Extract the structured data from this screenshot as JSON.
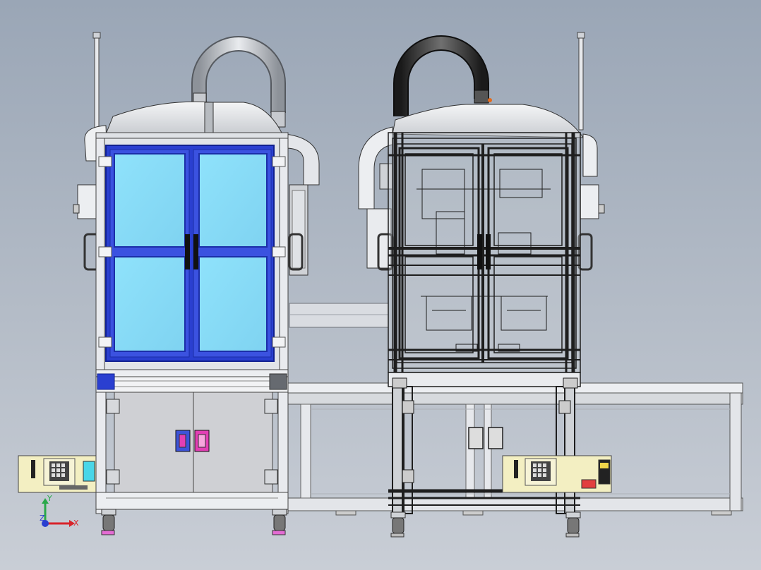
{
  "viewport": {
    "background_top": "#9aa6b6",
    "background_bottom": "#c9ced6"
  },
  "colors": {
    "frame_blue": "#2a3fd0",
    "glass_blue": "#86dcf8",
    "wire_black": "#1e1e1e",
    "aluminum": "#e6e8ec",
    "panel_grey": "#cfd0d4",
    "handle_pink": "#e23fb4",
    "handle_violet": "#3d53d8",
    "controller_beige": "#f3efc2",
    "axis_x": "#d8232a",
    "axis_y": "#2aa84a",
    "axis_z": "#2a3fd0"
  },
  "left_machine": {
    "name": "shaded-enclosure"
  },
  "right_machine": {
    "name": "wireframe-enclosure"
  },
  "triad": {
    "x_label": "X",
    "y_label": "Y",
    "z_label": "Z"
  }
}
